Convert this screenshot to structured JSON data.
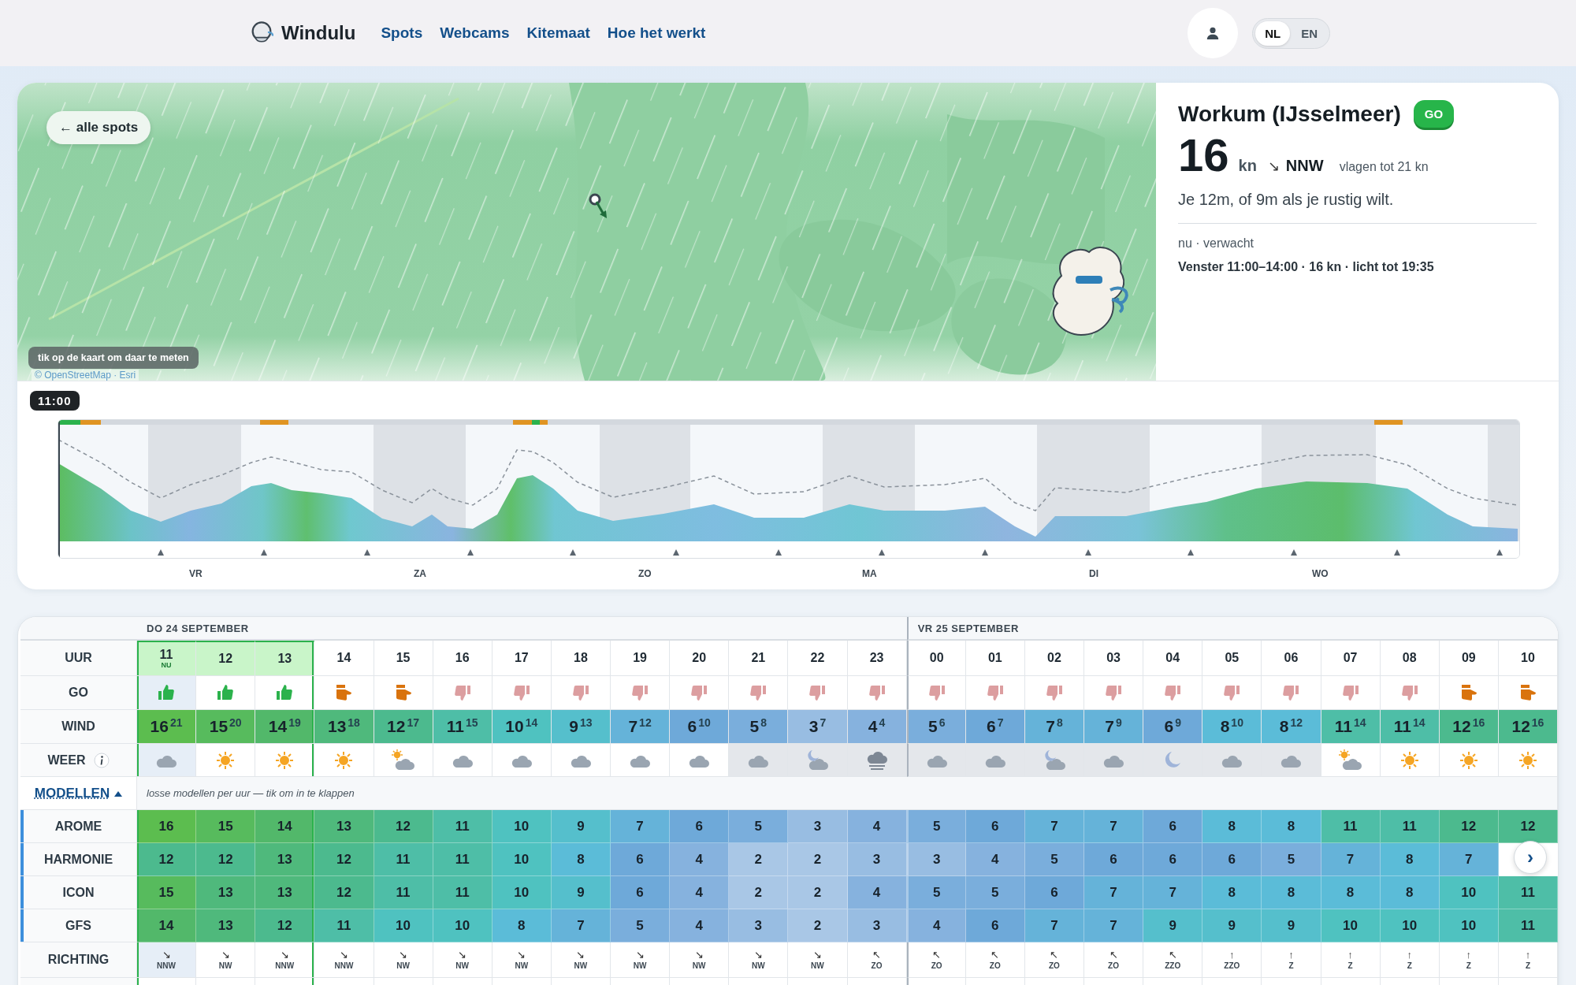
{
  "header": {
    "brand": "Windulu",
    "nav": [
      "Spots",
      "Webcams",
      "Kitemaat",
      "Hoe het werkt"
    ],
    "languages": [
      {
        "label": "NL",
        "selected": true
      },
      {
        "label": "EN",
        "selected": false
      }
    ]
  },
  "map": {
    "back_button": "← alle spots",
    "hint": "tik op de kaart om daar te meten",
    "attribution": "© OpenStreetMap · Esri"
  },
  "spot": {
    "name": "Workum (IJsselmeer)",
    "badge": "GO",
    "speed": "16",
    "unit": "kn",
    "direction_arrow": "↘",
    "direction": "NNW",
    "gusts": "vlagen tot 21 kn",
    "advice": "Je 12m, of 9m als je rustig wilt.",
    "mode": "nu · verwacht",
    "window": "Venster 11:00–14:00 · 16 kn · licht tot 19:35"
  },
  "timeline": {
    "marker": "11:00",
    "days": [
      "VR",
      "ZA",
      "ZO",
      "MA",
      "DI",
      "WO"
    ]
  },
  "table": {
    "row_labels": {
      "hour": "UUR",
      "go": "GO",
      "wind": "WIND",
      "weather": "WEER",
      "models": "MODELLEN",
      "direction": "RICHTING"
    },
    "models_note": "losse modellen per uur — tik om in te klappen",
    "days": [
      {
        "label": "DO 24 SEPTEMBER",
        "hours": [
          {
            "hour": "11",
            "tag": "NU",
            "now": true,
            "window": true,
            "night": false,
            "go": {
              "kind": "up"
            },
            "wind": "16",
            "gust": "21",
            "weather": {
              "kind": "cloud"
            },
            "arrow": "↘",
            "dir": "NNW"
          },
          {
            "hour": "12",
            "now": false,
            "window": true,
            "night": false,
            "go": {
              "kind": "up"
            },
            "wind": "15",
            "gust": "20",
            "weather": {
              "kind": "sun"
            },
            "arrow": "↘",
            "dir": "NW"
          },
          {
            "hour": "13",
            "now": false,
            "window": true,
            "night": false,
            "go": {
              "kind": "up"
            },
            "wind": "14",
            "gust": "19",
            "weather": {
              "kind": "sun"
            },
            "arrow": "↘",
            "dir": "NNW"
          },
          {
            "hour": "14",
            "now": false,
            "window": false,
            "night": false,
            "go": {
              "kind": "maybe"
            },
            "wind": "13",
            "gust": "18",
            "weather": {
              "kind": "sun"
            },
            "arrow": "↘",
            "dir": "NNW"
          },
          {
            "hour": "15",
            "now": false,
            "window": false,
            "night": false,
            "go": {
              "kind": "maybe"
            },
            "wind": "12",
            "gust": "17",
            "weather": {
              "kind": "sun-cloud"
            },
            "arrow": "↘",
            "dir": "NW"
          },
          {
            "hour": "16",
            "now": false,
            "window": false,
            "night": false,
            "go": {
              "kind": "down"
            },
            "wind": "11",
            "gust": "15",
            "weather": {
              "kind": "cloud"
            },
            "arrow": "↘",
            "dir": "NW"
          },
          {
            "hour": "17",
            "now": false,
            "window": false,
            "night": false,
            "go": {
              "kind": "down"
            },
            "wind": "10",
            "gust": "14",
            "weather": {
              "kind": "cloud"
            },
            "arrow": "↘",
            "dir": "NW"
          },
          {
            "hour": "18",
            "now": false,
            "window": false,
            "night": false,
            "go": {
              "kind": "down"
            },
            "wind": "9",
            "gust": "13",
            "weather": {
              "kind": "cloud"
            },
            "arrow": "↘",
            "dir": "NW"
          },
          {
            "hour": "19",
            "now": false,
            "window": false,
            "night": false,
            "go": {
              "kind": "down"
            },
            "wind": "7",
            "gust": "12",
            "weather": {
              "kind": "cloud"
            },
            "arrow": "↘",
            "dir": "NW"
          },
          {
            "hour": "20",
            "now": false,
            "window": false,
            "night": false,
            "go": {
              "kind": "down"
            },
            "wind": "6",
            "gust": "10",
            "weather": {
              "kind": "cloud"
            },
            "arrow": "↘",
            "dir": "NW"
          },
          {
            "hour": "21",
            "now": false,
            "window": false,
            "night": true,
            "go": {
              "kind": "down"
            },
            "wind": "5",
            "gust": "8",
            "weather": {
              "kind": "cloud"
            },
            "arrow": "↘",
            "dir": "NW"
          },
          {
            "hour": "22",
            "now": false,
            "window": false,
            "night": true,
            "go": {
              "kind": "down"
            },
            "wind": "3",
            "gust": "7",
            "weather": {
              "kind": "moon-cloud"
            },
            "arrow": "↘",
            "dir": "NW"
          },
          {
            "hour": "23",
            "now": false,
            "window": false,
            "night": true,
            "go": {
              "kind": "down"
            },
            "wind": "4",
            "gust": "4",
            "weather": {
              "kind": "fog"
            },
            "arrow": "↖",
            "dir": "ZO"
          }
        ]
      },
      {
        "label": "VR 25 SEPTEMBER",
        "hours": [
          {
            "hour": "00",
            "now": false,
            "window": false,
            "night": true,
            "go": {
              "kind": "down"
            },
            "wind": "5",
            "gust": "6",
            "weather": {
              "kind": "cloud"
            },
            "arrow": "↖",
            "dir": "ZO"
          },
          {
            "hour": "01",
            "now": false,
            "window": false,
            "night": true,
            "go": {
              "kind": "down"
            },
            "wind": "6",
            "gust": "7",
            "weather": {
              "kind": "cloud"
            },
            "arrow": "↖",
            "dir": "ZO"
          },
          {
            "hour": "02",
            "now": false,
            "window": false,
            "night": true,
            "go": {
              "kind": "down"
            },
            "wind": "7",
            "gust": "8",
            "weather": {
              "kind": "moon-cloud"
            },
            "arrow": "↖",
            "dir": "ZO"
          },
          {
            "hour": "03",
            "now": false,
            "window": false,
            "night": true,
            "go": {
              "kind": "down"
            },
            "wind": "7",
            "gust": "9",
            "weather": {
              "kind": "cloud"
            },
            "arrow": "↖",
            "dir": "ZO"
          },
          {
            "hour": "04",
            "now": false,
            "window": false,
            "night": true,
            "go": {
              "kind": "down"
            },
            "wind": "6",
            "gust": "9",
            "weather": {
              "kind": "moon"
            },
            "arrow": "↖",
            "dir": "ZZO"
          },
          {
            "hour": "05",
            "now": false,
            "window": false,
            "night": true,
            "go": {
              "kind": "down"
            },
            "wind": "8",
            "gust": "10",
            "weather": {
              "kind": "cloud"
            },
            "arrow": "↑",
            "dir": "ZZO"
          },
          {
            "hour": "06",
            "now": false,
            "window": false,
            "night": true,
            "go": {
              "kind": "down"
            },
            "wind": "8",
            "gust": "12",
            "weather": {
              "kind": "cloud"
            },
            "arrow": "↑",
            "dir": "Z"
          },
          {
            "hour": "07",
            "now": false,
            "window": false,
            "night": false,
            "go": {
              "kind": "down"
            },
            "wind": "11",
            "gust": "14",
            "weather": {
              "kind": "sun-cloud"
            },
            "arrow": "↑",
            "dir": "Z"
          },
          {
            "hour": "08",
            "now": false,
            "window": false,
            "night": false,
            "go": {
              "kind": "down"
            },
            "wind": "11",
            "gust": "14",
            "weather": {
              "kind": "sun"
            },
            "arrow": "↑",
            "dir": "Z"
          },
          {
            "hour": "09",
            "now": false,
            "window": false,
            "night": false,
            "go": {
              "kind": "maybe"
            },
            "wind": "12",
            "gust": "16",
            "weather": {
              "kind": "sun"
            },
            "arrow": "↑",
            "dir": "Z"
          },
          {
            "hour": "10",
            "now": false,
            "window": false,
            "night": false,
            "go": {
              "kind": "maybe"
            },
            "wind": "12",
            "gust": "16",
            "weather": {
              "kind": "sun"
            },
            "arrow": "↑",
            "dir": "Z"
          }
        ]
      }
    ],
    "models": [
      {
        "name": "AROME",
        "values": [
          "16",
          "15",
          "14",
          "13",
          "12",
          "11",
          "10",
          "9",
          "7",
          "6",
          "5",
          "3",
          "4",
          "5",
          "6",
          "7",
          "7",
          "6",
          "8",
          "8",
          "11",
          "11",
          "12",
          "12"
        ]
      },
      {
        "name": "HARMONIE",
        "values": [
          "12",
          "12",
          "13",
          "12",
          "11",
          "11",
          "10",
          "8",
          "6",
          "4",
          "2",
          "2",
          "3",
          "3",
          "4",
          "5",
          "6",
          "6",
          "6",
          "5",
          "7",
          "8",
          "7"
        ]
      },
      {
        "name": "ICON",
        "values": [
          "15",
          "13",
          "13",
          "12",
          "11",
          "11",
          "10",
          "9",
          "6",
          "4",
          "2",
          "2",
          "4",
          "5",
          "5",
          "6",
          "7",
          "7",
          "8",
          "8",
          "8",
          "8",
          "10",
          "11"
        ]
      },
      {
        "name": "GFS",
        "values": [
          "14",
          "13",
          "12",
          "11",
          "10",
          "10",
          "8",
          "7",
          "5",
          "4",
          "3",
          "2",
          "3",
          "4",
          "6",
          "7",
          "7",
          "9",
          "9",
          "9",
          "10",
          "10",
          "10",
          "11"
        ]
      }
    ],
    "next_button": "›"
  }
}
